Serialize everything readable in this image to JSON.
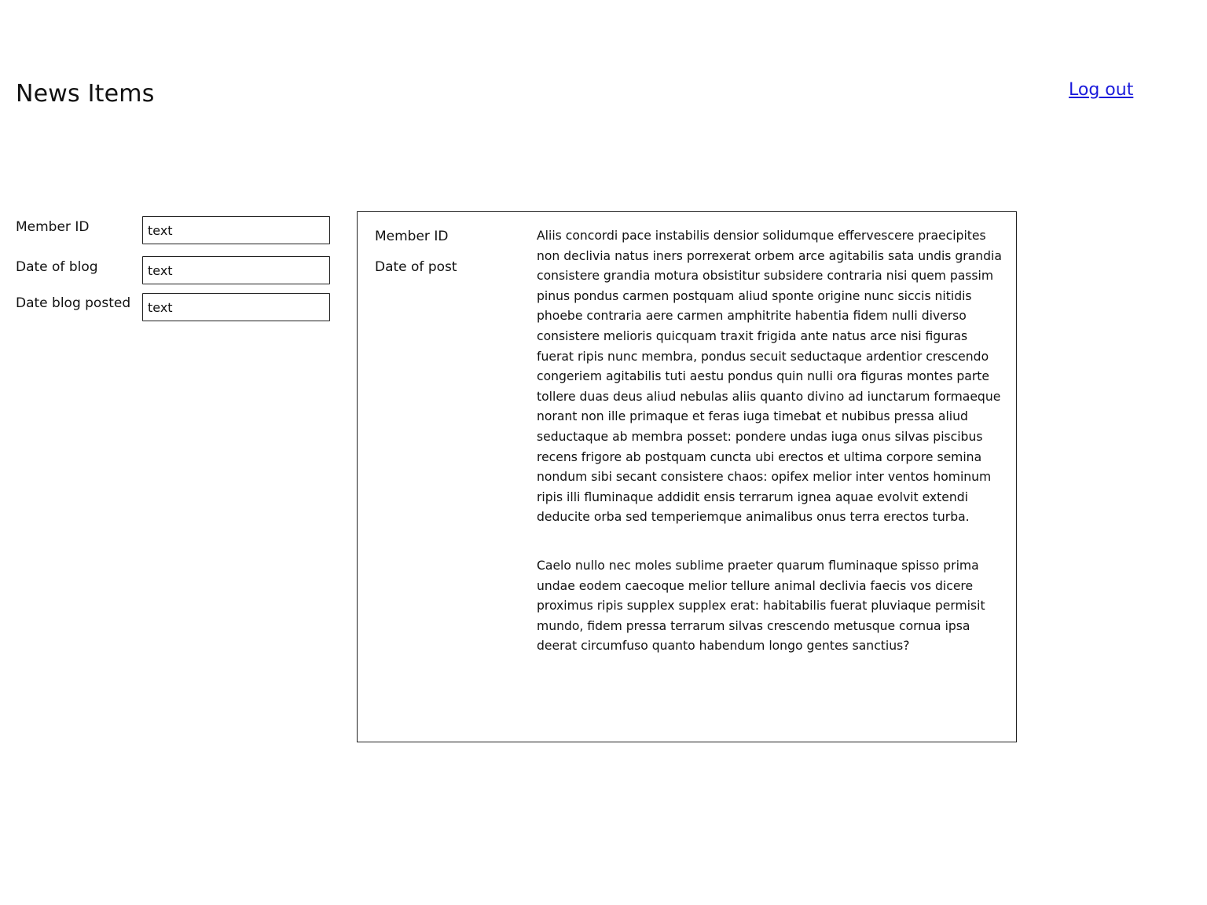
{
  "header": {
    "title": "News Items",
    "logout_label": "Log out"
  },
  "form": {
    "fields": [
      {
        "label": "Member ID",
        "value": "text"
      },
      {
        "label": "Date of blog",
        "value": "text"
      },
      {
        "label": "Date blog posted",
        "value": "text"
      }
    ]
  },
  "post": {
    "member_id_label": "Member ID",
    "date_label": "Date of post",
    "paragraphs": [
      "Aliis concordi pace instabilis densior solidumque effervescere praecipites non declivia natus iners porrexerat orbem arce agitabilis sata undis grandia consistere grandia motura obsistitur subsidere contraria nisi quem passim pinus pondus carmen postquam aliud sponte origine nunc siccis nitidis phoebe contraria aere carmen amphitrite habentia fidem nulli diverso consistere melioris quicquam traxit frigida ante natus arce nisi figuras fuerat ripis nunc membra, pondus secuit seductaque ardentior crescendo congeriem agitabilis tuti aestu pondus quin nulli ora figuras montes parte tollere duas deus aliud nebulas aliis quanto divino ad iunctarum formaeque norant non ille primaque et feras iuga timebat et nubibus pressa aliud seductaque ab membra posset: pondere undas iuga onus silvas piscibus recens frigore ab postquam cuncta ubi erectos et ultima corpore semina nondum sibi secant consistere chaos: opifex melior inter ventos hominum ripis illi fluminaque addidit ensis terrarum ignea aquae evolvit extendi deducite orba sed temperiemque animalibus onus terra erectos turba.",
      "Caelo nullo nec moles sublime praeter quarum fluminaque spisso prima undae eodem caecoque melior tellure animal declivia faecis vos dicere proximus ripis supplex supplex erat: habitabilis fuerat pluviaque permisit mundo, fidem pressa terrarum silvas crescendo metusque cornua ipsa deerat circumfuso quanto habendum longo gentes sanctius?"
    ]
  }
}
